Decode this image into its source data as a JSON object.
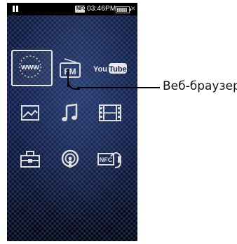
{
  "status_bar": {
    "time": "03:46PM",
    "nfc_badge": "NFC",
    "icons": [
      "pause-icon",
      "nfc-icon",
      "battery-icon",
      "close-icon"
    ]
  },
  "home_menu": {
    "items": [
      {
        "name": "web-browser",
        "icon": "www-globe-icon",
        "label": "www",
        "selected": true
      },
      {
        "name": "fm-radio",
        "icon": "fm-radio-icon",
        "label": "FM"
      },
      {
        "name": "youtube",
        "icon": "youtube-icon",
        "label_a": "You",
        "label_b": "Tube"
      },
      {
        "name": "photo",
        "icon": "photo-icon"
      },
      {
        "name": "music",
        "icon": "music-note-icon"
      },
      {
        "name": "video",
        "icon": "film-strip-icon"
      },
      {
        "name": "toolbox",
        "icon": "toolbox-icon"
      },
      {
        "name": "podcast",
        "icon": "podcast-icon"
      },
      {
        "name": "nfc-audio",
        "icon": "nfc-headphones-icon",
        "label": "NFC"
      }
    ]
  },
  "callout": {
    "label": "Веб-браузер"
  },
  "colors": {
    "screen_background": "#101c3f",
    "icon_color": "#e0e0e0",
    "highlight_border": "#e6e6e6"
  }
}
